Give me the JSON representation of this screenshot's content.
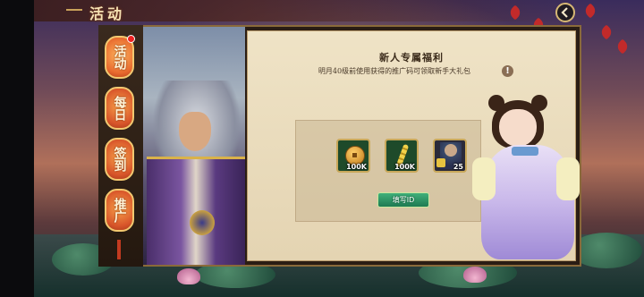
{
  "header": {
    "title": "活动"
  },
  "tabs": [
    {
      "label": "活动",
      "active": true,
      "badge": true
    },
    {
      "label": "每日",
      "active": false
    },
    {
      "label": "签到",
      "active": false
    },
    {
      "label": "推广",
      "active": false
    }
  ],
  "promo": {
    "title": "新人专属福利",
    "description": "明月40级前使用获得的推广码可领取新手大礼包",
    "info_icon": "!",
    "rewards": [
      {
        "icon": "copper-coin-icon",
        "count": "100K"
      },
      {
        "icon": "grain-icon",
        "count": "100K"
      },
      {
        "icon": "hero-fragment-icon",
        "count": "25"
      }
    ],
    "button_label": "填写ID"
  },
  "colors": {
    "tab_orange": "#e86a2e",
    "panel_bg": "#efe3c6",
    "button_green": "#2f9a66",
    "title_gold": "#f6e2b4"
  }
}
